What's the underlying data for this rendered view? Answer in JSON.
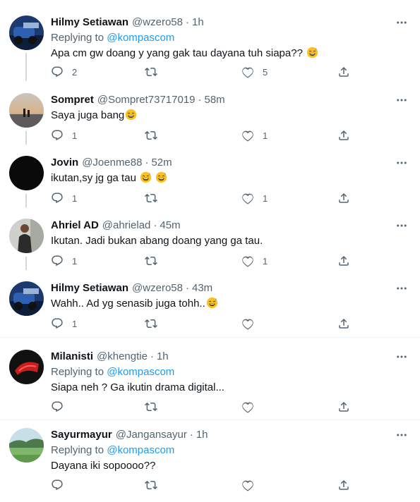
{
  "colors": {
    "link": "#1d9bf0",
    "secondary": "#536471",
    "text": "#0f1419",
    "thread_line": "#cfd9de"
  },
  "icons": {
    "reply": "reply-icon",
    "retweet": "retweet-icon",
    "like": "heart-icon",
    "share": "share-icon",
    "more": "more-icon"
  },
  "tweets": [
    {
      "name": "Hilmy Setiawan",
      "handle": "@wzero58",
      "dot": "·",
      "time": "1h",
      "replying_prefix": "Replying to",
      "replying_to": "@kompascom",
      "text": "Apa cm gw doang y yang gak tau dayana tuh siapa??",
      "replies": "2",
      "retweets": "",
      "likes": "5"
    },
    {
      "name": "Sompret",
      "handle": "@Sompret73717019",
      "dot": "·",
      "time": "58m",
      "text": "Saya juga bang",
      "replies": "1",
      "retweets": "",
      "likes": "1"
    },
    {
      "name": "Jovin",
      "handle": "@Joenme88",
      "dot": "·",
      "time": "52m",
      "text": "ikutan,sy jg ga tau",
      "replies": "1",
      "retweets": "",
      "likes": "1"
    },
    {
      "name": "Ahriel AD",
      "handle": "@ahrielad",
      "dot": "·",
      "time": "45m",
      "text": "Ikutan. Jadi bukan abang doang yang ga tau.",
      "replies": "1",
      "retweets": "",
      "likes": "1"
    },
    {
      "name": "Hilmy Setiawan",
      "handle": "@wzero58",
      "dot": "·",
      "time": "43m",
      "text": "Wahh.. Ad yg senasib juga tohh..",
      "replies": "1",
      "retweets": "",
      "likes": ""
    },
    {
      "name": "Milanisti",
      "handle": "@khengtie",
      "dot": "·",
      "time": "1h",
      "replying_prefix": "Replying to",
      "replying_to": "@kompascom",
      "text": "Siapa neh ? Ga ikutin drama digital...",
      "replies": "",
      "retweets": "",
      "likes": ""
    },
    {
      "name": "Sayurmayur",
      "handle": "@Jangansayur",
      "dot": "·",
      "time": "1h",
      "replying_prefix": "Replying to",
      "replying_to": "@kompascom",
      "text": "Dayana iki sopoooo??",
      "replies": "",
      "retweets": "",
      "likes": ""
    }
  ]
}
